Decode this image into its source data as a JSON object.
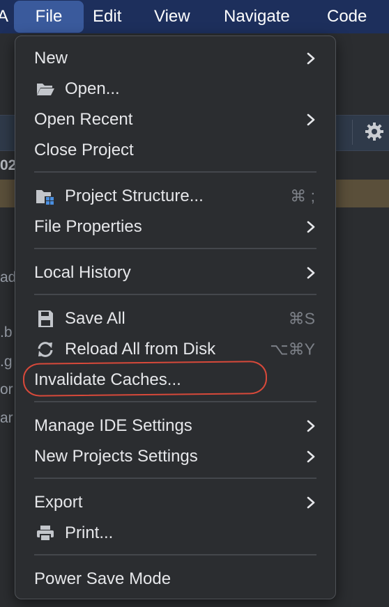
{
  "menubar": {
    "items": [
      "A",
      "File",
      "Edit",
      "View",
      "Navigate",
      "Code"
    ],
    "active_item": "File",
    "bg_color": "#1d2f5c",
    "active_color": "#3a5a9c"
  },
  "background": {
    "fragments": [
      "02",
      "ad",
      ".b",
      ".g",
      "or",
      "ar"
    ],
    "gear_icon": "gear-icon"
  },
  "file_menu": {
    "items": [
      {
        "label": "New",
        "submenu": true
      },
      {
        "label": "Open...",
        "icon": "folder-open-icon"
      },
      {
        "label": "Open Recent",
        "submenu": true
      },
      {
        "label": "Close Project"
      },
      {
        "label": "Project Structure...",
        "icon": "project-structure-icon",
        "shortcut": "⌘ ;"
      },
      {
        "label": "File Properties",
        "submenu": true
      },
      {
        "label": "Local History",
        "submenu": true
      },
      {
        "label": "Save All",
        "icon": "save-icon",
        "shortcut": "⌘S"
      },
      {
        "label": "Reload All from Disk",
        "icon": "reload-icon",
        "shortcut": "⌥⌘Y"
      },
      {
        "label": "Invalidate Caches...",
        "highlighted": true
      },
      {
        "label": "Manage IDE Settings",
        "submenu": true
      },
      {
        "label": "New Projects Settings",
        "submenu": true
      },
      {
        "label": "Export",
        "submenu": true
      },
      {
        "label": "Print...",
        "icon": "print-icon"
      },
      {
        "label": "Power Save Mode"
      }
    ],
    "annotation_color": "#d8493a"
  }
}
